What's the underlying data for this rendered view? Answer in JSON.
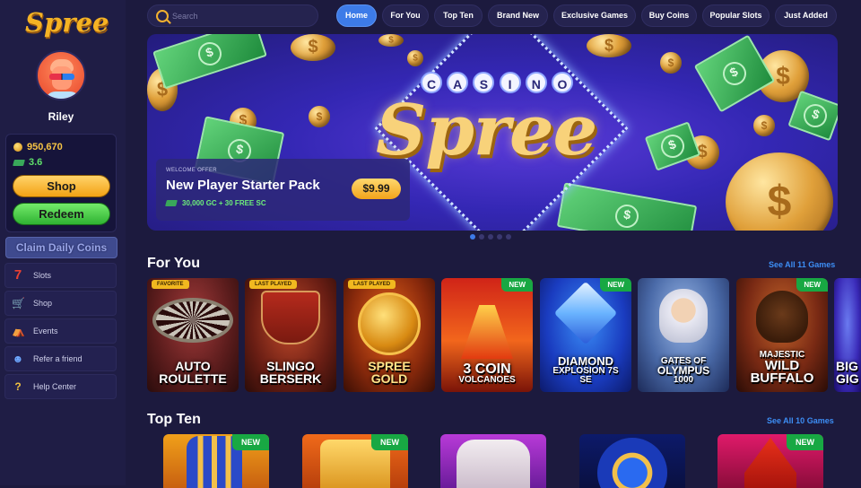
{
  "brand": {
    "logo_text": "Spree"
  },
  "user": {
    "name": "Riley",
    "gold_coins": "950,670",
    "sweeps_coins": "3.6"
  },
  "sidebar": {
    "shop_label": "Shop",
    "redeem_label": "Redeem",
    "claim_label": "Claim Daily Coins",
    "items": [
      {
        "label": "Slots",
        "icon": "slot-seven-icon"
      },
      {
        "label": "Shop",
        "icon": "cart-icon"
      },
      {
        "label": "Events",
        "icon": "events-icon"
      },
      {
        "label": "Refer a friend",
        "icon": "refer-friend-icon"
      },
      {
        "label": "Help Center",
        "icon": "help-icon"
      }
    ]
  },
  "search": {
    "placeholder": "Search"
  },
  "tabs": [
    {
      "label": "Home",
      "active": true
    },
    {
      "label": "For You"
    },
    {
      "label": "Top Ten"
    },
    {
      "label": "Brand New"
    },
    {
      "label": "Exclusive Games"
    },
    {
      "label": "Buy Coins"
    },
    {
      "label": "Popular Slots"
    },
    {
      "label": "Just Added"
    }
  ],
  "banner": {
    "casino_letters": [
      "C",
      "A",
      "S",
      "I",
      "N",
      "O"
    ],
    "brand_word": "Spree",
    "offer_kicker": "WELCOME OFFER",
    "offer_title": "New Player Starter Pack",
    "offer_price": "$9.99",
    "offer_sub": "30,000 GC + 30 FREE SC",
    "slides": 5,
    "active_slide": 1
  },
  "for_you": {
    "title": "For You",
    "see_all": "See All 11 Games",
    "games": [
      {
        "line1": "AUTO",
        "line2": "ROULETTE",
        "badge": "FAVORITE",
        "badge_type": "y"
      },
      {
        "line1": "SLINGO",
        "line2": "BERSERK",
        "badge": "LAST PLAYED",
        "badge_type": "y"
      },
      {
        "line1": "SPREE",
        "line2": "GOLD",
        "badge": "LAST PLAYED",
        "badge_type": "y"
      },
      {
        "line1": "3 COIN",
        "line2": "VOLCANOES",
        "badge": "NEW",
        "badge_type": "g"
      },
      {
        "line1": "DIAMOND",
        "line2": "EXPLOSION 7S",
        "line3": "SE",
        "badge": "NEW",
        "badge_type": "g"
      },
      {
        "line1": "GATES OF",
        "line2": "OLYMPUS",
        "line3": "1000",
        "badge": "",
        "badge_type": ""
      },
      {
        "line1": "MAJESTIC",
        "line2": "WILD",
        "line3": "BUFFALO",
        "badge": "NEW",
        "badge_type": "g"
      },
      {
        "line1": "BIG",
        "line2": "GIG",
        "badge": "",
        "badge_type": ""
      }
    ]
  },
  "top_ten": {
    "title": "Top Ten",
    "see_all": "See All 10 Games",
    "badges": [
      "NEW",
      "NEW",
      "",
      "",
      "NEW"
    ]
  },
  "colors": {
    "accent": "#3d7be8",
    "gold": "#f3a214",
    "green": "#2fb232",
    "background": "#1c1a3e"
  }
}
